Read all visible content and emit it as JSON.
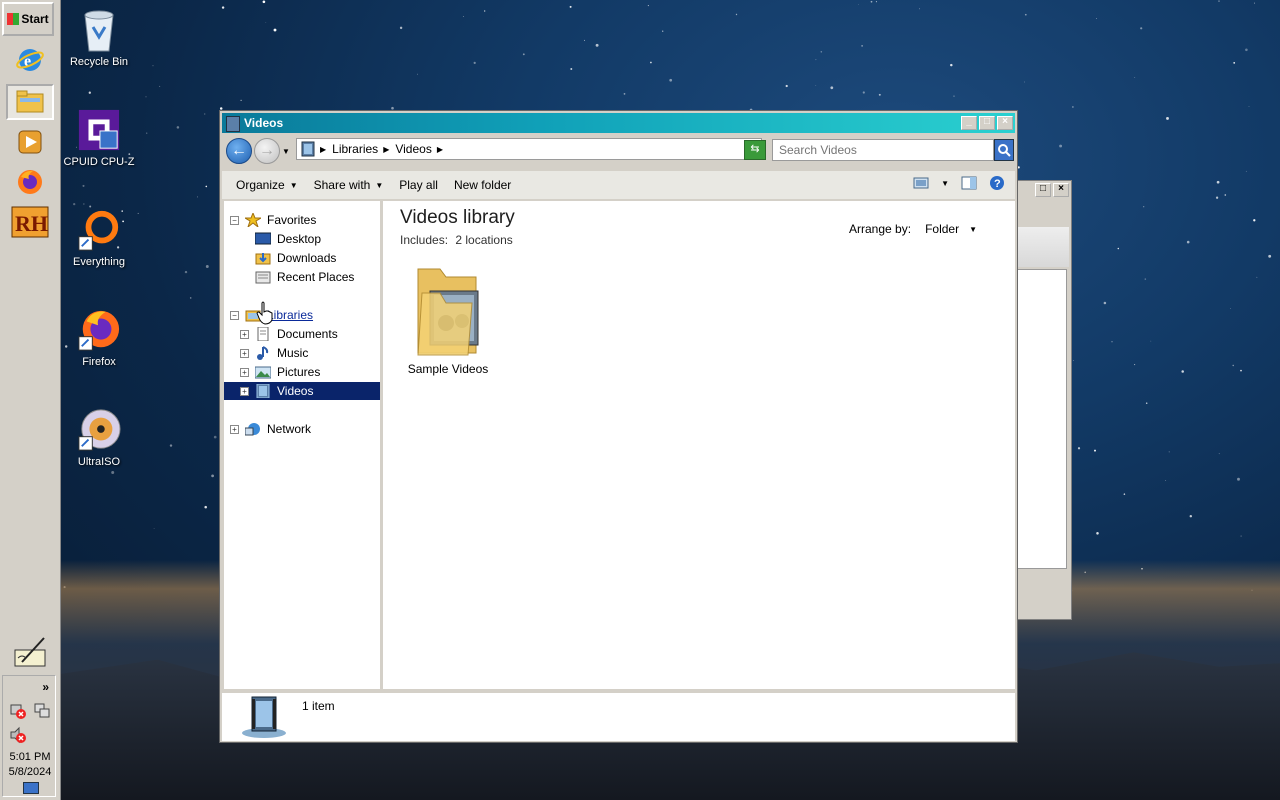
{
  "taskbar": {
    "start_label": "Start",
    "clock_time": "5:01 PM",
    "clock_date": "5/8/2024",
    "pinned": [
      {
        "name": "internet-explorer-icon"
      },
      {
        "name": "file-explorer-icon"
      },
      {
        "name": "media-player-icon"
      },
      {
        "name": "firefox-icon"
      },
      {
        "name": "resource-hacker-icon"
      }
    ],
    "tray_expand": "»"
  },
  "desktop": {
    "icons": [
      {
        "label": "Recycle Bin",
        "icon": "recycle-bin-icon"
      },
      {
        "label": "CPUID CPU-Z",
        "icon": "cpu-z-icon"
      },
      {
        "label": "Everything",
        "icon": "everything-icon"
      },
      {
        "label": "Firefox",
        "icon": "firefox-icon"
      },
      {
        "label": "UltraISO",
        "icon": "ultraiso-icon"
      }
    ]
  },
  "window": {
    "title": "Videos",
    "address": {
      "crumbs": [
        "Libraries",
        "Videos"
      ]
    },
    "search_placeholder": "Search Videos",
    "toolbar": {
      "organize": "Organize",
      "share_with": "Share with",
      "play_all": "Play all",
      "new_folder": "New folder"
    },
    "nav": {
      "favorites": "Favorites",
      "desktop": "Desktop",
      "downloads": "Downloads",
      "recent_places": "Recent Places",
      "libraries": "Libraries",
      "documents": "Documents",
      "music": "Music",
      "pictures": "Pictures",
      "videos": "Videos",
      "network": "Network"
    },
    "content": {
      "title": "Videos library",
      "includes_label": "Includes:",
      "includes_value": "2 locations",
      "arrange_label": "Arrange by:",
      "arrange_value": "Folder",
      "items": [
        {
          "label": "Sample Videos"
        }
      ]
    },
    "status": {
      "count": "1 item"
    }
  },
  "colors": {
    "titlebar": "#10a0b8",
    "selection": "#0a246a",
    "chrome": "#d4d0c8"
  }
}
